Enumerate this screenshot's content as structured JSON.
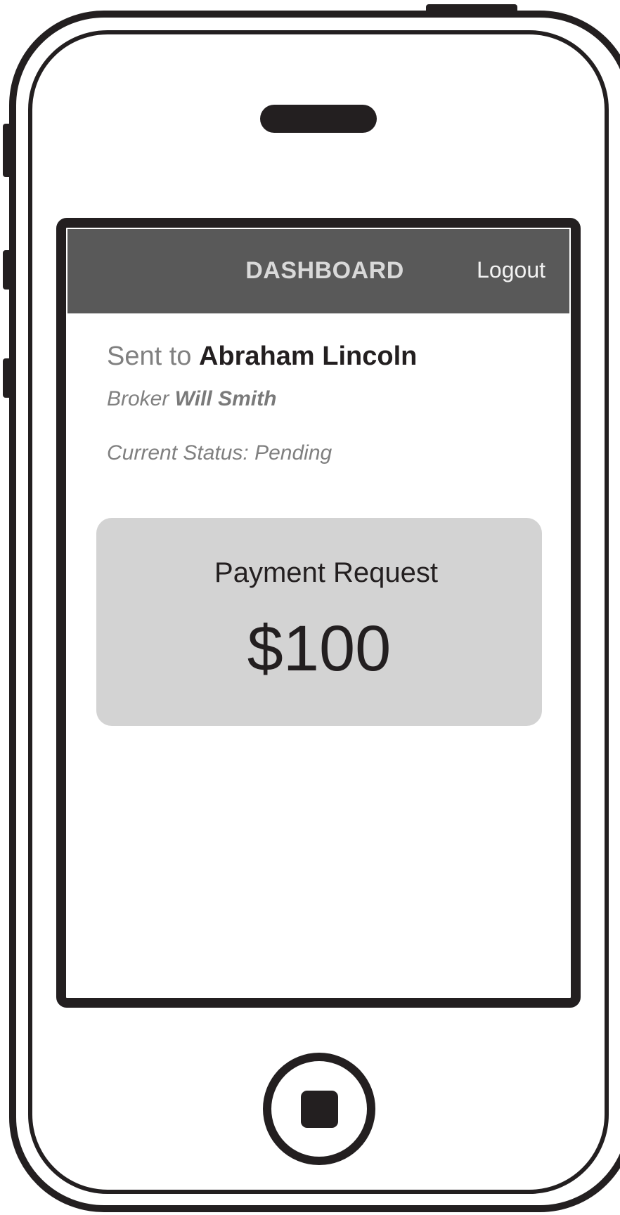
{
  "header": {
    "title": "DASHBOARD",
    "logout_label": "Logout"
  },
  "details": {
    "sent_prefix": "Sent to ",
    "recipient_name": "Abraham Lincoln",
    "broker_prefix": "Broker ",
    "broker_name": "Will Smith",
    "status_text": "Current Status:  Pending"
  },
  "payment": {
    "title": "Payment Request",
    "amount": "$100"
  },
  "colors": {
    "header_bg": "#595959",
    "card_bg": "#d3d3d3",
    "frame": "#231f20"
  },
  "icons": {
    "speaker": "speaker-grille-icon",
    "home": "home-button-icon"
  }
}
